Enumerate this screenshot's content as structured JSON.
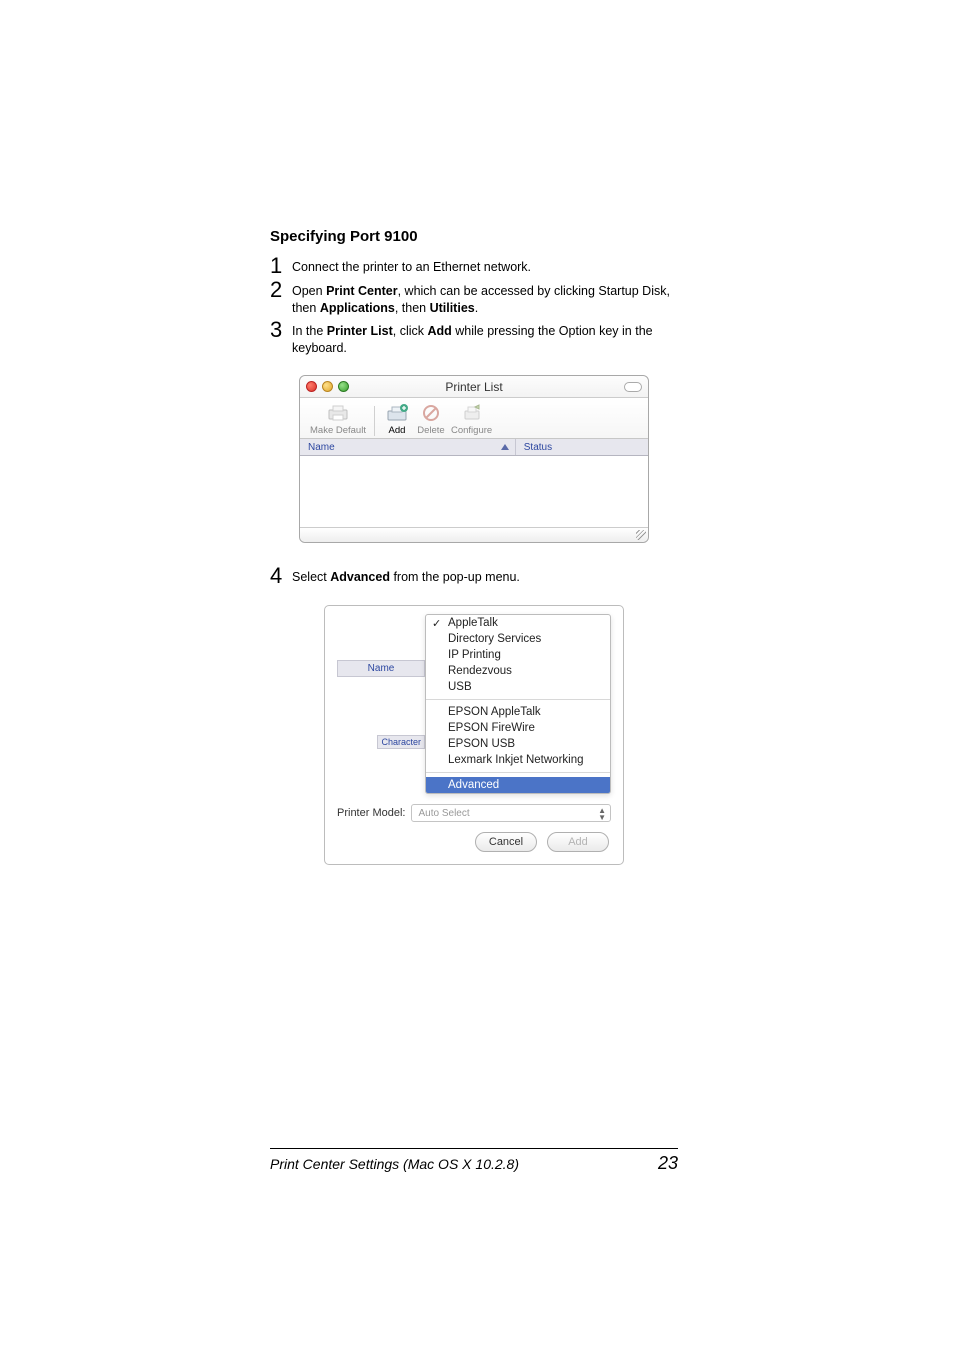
{
  "heading": "Specifying Port 9100",
  "steps": {
    "s1": {
      "num": "1",
      "text": "Connect the printer to an Ethernet network."
    },
    "s2": {
      "num": "2",
      "pre": "Open ",
      "b1": "Print Center",
      "mid1": ", which can be accessed by clicking Startup Disk, then ",
      "b2": "Applications",
      "mid2": ", then ",
      "b3": "Utilities",
      "post": "."
    },
    "s3": {
      "num": "3",
      "pre": "In the ",
      "b1": "Printer List",
      "mid1": ", click ",
      "b2": "Add",
      "post": " while pressing the Option key in the keyboard."
    },
    "s4": {
      "num": "4",
      "pre": "Select ",
      "b1": "Advanced",
      "post": " from the pop-up menu."
    }
  },
  "fig1": {
    "title": "Printer List",
    "toolbar": {
      "makeDefault": "Make Default",
      "add": "Add",
      "delete": "Delete",
      "configure": "Configure"
    },
    "columns": {
      "name": "Name",
      "status": "Status"
    }
  },
  "fig2": {
    "leftHeading": "Name",
    "charLabel": "Character",
    "menu": {
      "appleTalk": "AppleTalk",
      "directoryServices": "Directory Services",
      "ipPrinting": "IP Printing",
      "rendezvous": "Rendezvous",
      "usb": "USB",
      "epsonAppleTalk": "EPSON AppleTalk",
      "epsonFireWire": "EPSON FireWire",
      "epsonUSB": "EPSON USB",
      "lexmark": "Lexmark Inkjet Networking",
      "advanced": "Advanced"
    },
    "modelLabel": "Printer Model:",
    "modelValue": "Auto Select",
    "cancel": "Cancel",
    "add": "Add"
  },
  "footer": {
    "left": "Print Center Settings (Mac OS X 10.2.8)",
    "right": "23"
  }
}
